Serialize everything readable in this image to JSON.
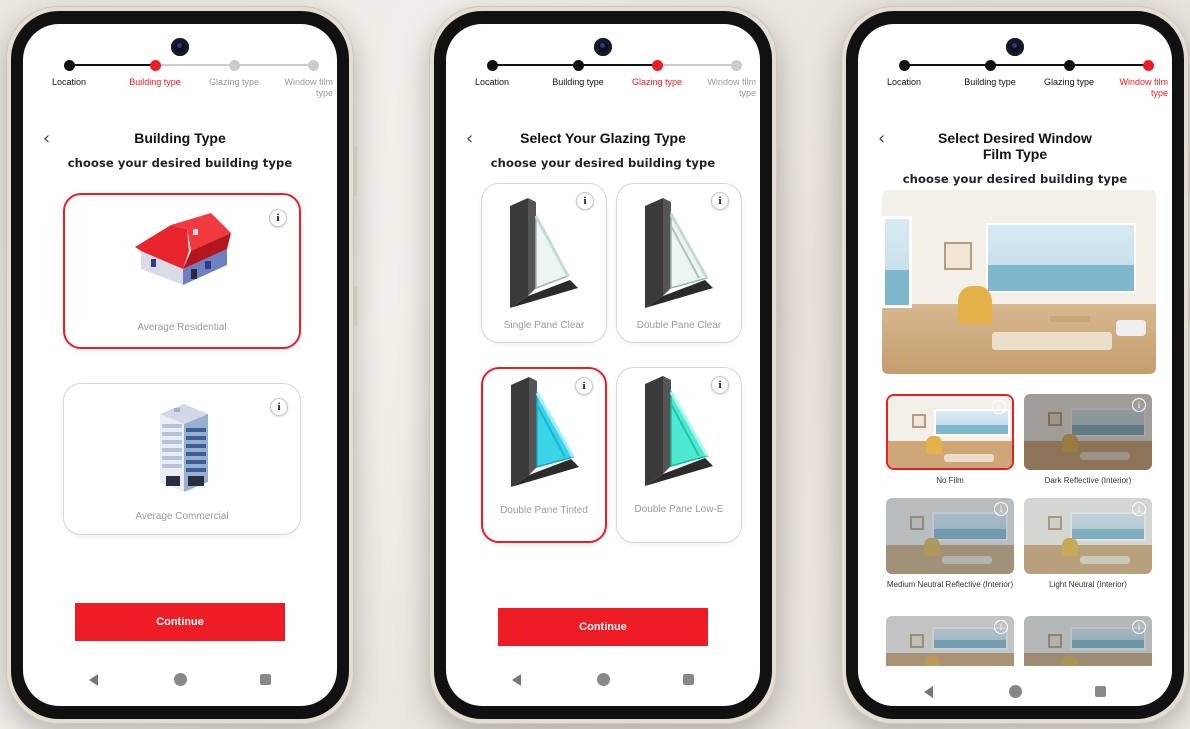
{
  "steps": [
    "Location",
    "Building type",
    "Glazing type",
    "Window film type"
  ],
  "colors": {
    "accent": "#ee1c24",
    "done": "#111111",
    "pending": "#cccccc"
  },
  "screen1": {
    "title": "Building Type",
    "subtitle": "choose your desired building type",
    "options": [
      {
        "label": "Average Residential",
        "icon": "residential-house-icon",
        "selected": true
      },
      {
        "label": "Average Commercial",
        "icon": "commercial-building-icon",
        "selected": false
      }
    ],
    "continue": "Continue"
  },
  "screen2": {
    "title": "Select Your Glazing Type",
    "subtitle": "choose your desired building type",
    "options": [
      {
        "label": "Single Pane Clear",
        "icon": "single-pane-window-icon",
        "selected": false
      },
      {
        "label": "Double Pane Clear",
        "icon": "double-pane-window-icon",
        "selected": false
      },
      {
        "label": "Double Pane Tinted",
        "icon": "tinted-window-icon",
        "selected": true
      },
      {
        "label": "Double Pane Low-E",
        "icon": "low-e-window-icon",
        "selected": false
      }
    ],
    "continue": "Continue"
  },
  "screen3": {
    "title": "Select Desired Window Film Type",
    "subtitle": "choose your desired building type",
    "films": [
      {
        "label": "No Film",
        "selected": true
      },
      {
        "label": "Dark Reflective (Interior)",
        "selected": false
      },
      {
        "label": "Medium Neutral Reflective (Interior)",
        "selected": false
      },
      {
        "label": "Light Neutral (Interior)",
        "selected": false
      },
      {
        "label": "",
        "selected": false
      },
      {
        "label": "",
        "selected": false
      }
    ]
  },
  "info_glyph": "i",
  "back_glyph": "‹"
}
